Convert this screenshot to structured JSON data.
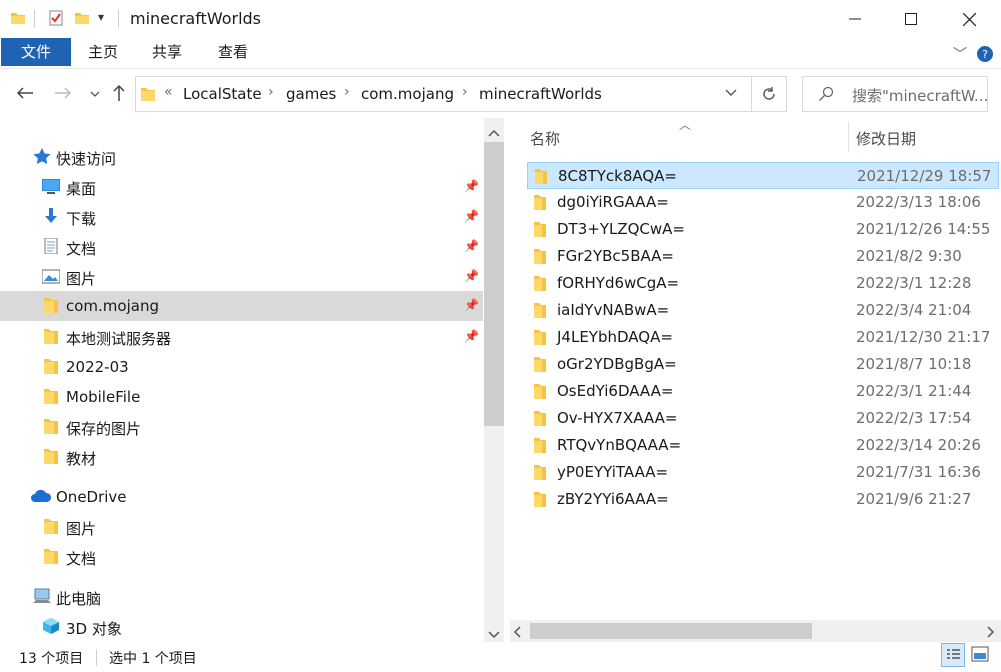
{
  "window": {
    "title": "minecraftWorlds",
    "minimize_icon": "minimize-icon",
    "maximize_icon": "maximize-icon",
    "close_icon": "close-icon"
  },
  "ribbon": {
    "tabs": [
      "文件",
      "主页",
      "共享",
      "查看"
    ]
  },
  "address": {
    "overflow": "«",
    "crumbs": [
      "LocalState",
      "games",
      "com.mojang",
      "minecraftWorlds"
    ],
    "search_placeholder": "搜索\"minecraftW..."
  },
  "nav": {
    "quick_access": "快速访问",
    "items": [
      {
        "label": "桌面",
        "icon": "desktop-icon",
        "pinned": true
      },
      {
        "label": "下载",
        "icon": "download-icon",
        "pinned": true
      },
      {
        "label": "文档",
        "icon": "document-icon",
        "pinned": true
      },
      {
        "label": "图片",
        "icon": "picture-icon",
        "pinned": true
      },
      {
        "label": "com.mojang",
        "icon": "folder-icon",
        "pinned": true,
        "selected": true
      },
      {
        "label": "本地测试服务器",
        "icon": "folder-icon",
        "pinned": true
      },
      {
        "label": "2022-03",
        "icon": "folder-icon"
      },
      {
        "label": "MobileFile",
        "icon": "folder-icon"
      },
      {
        "label": "保存的图片",
        "icon": "folder-icon"
      },
      {
        "label": "教材",
        "icon": "folder-icon"
      }
    ],
    "onedrive": "OneDrive",
    "onedrive_items": [
      {
        "label": "图片",
        "icon": "folder-icon"
      },
      {
        "label": "文档",
        "icon": "folder-icon"
      }
    ],
    "this_pc": "此电脑",
    "this_pc_items": [
      {
        "label": "3D 对象",
        "icon": "3d-objects-icon"
      }
    ]
  },
  "columns": {
    "name": "名称",
    "date": "修改日期"
  },
  "files": [
    {
      "name": "8C8TYck8AQA=",
      "date": "2021/12/29 18:57",
      "selected": true
    },
    {
      "name": "dg0iYiRGAAA=",
      "date": "2022/3/13 18:06"
    },
    {
      "name": "DT3+YLZQCwA=",
      "date": "2021/12/26 14:55"
    },
    {
      "name": "FGr2YBc5BAA=",
      "date": "2021/8/2 9:30"
    },
    {
      "name": "fORHYd6wCgA=",
      "date": "2022/3/1 12:28"
    },
    {
      "name": "iaIdYvNABwA=",
      "date": "2022/3/4 21:04"
    },
    {
      "name": "J4LEYbhDAQA=",
      "date": "2021/12/30 21:17"
    },
    {
      "name": "oGr2YDBgBgA=",
      "date": "2021/8/7 10:18"
    },
    {
      "name": "OsEdYi6DAAA=",
      "date": "2022/3/1 21:44"
    },
    {
      "name": "Ov-HYX7XAAA=",
      "date": "2022/2/3 17:54"
    },
    {
      "name": "RTQvYnBQAAA=",
      "date": "2022/3/14 20:26"
    },
    {
      "name": "yP0EYYiTAAA=",
      "date": "2021/7/31 16:36"
    },
    {
      "name": "zBY2YYi6AAA=",
      "date": "2021/9/6 21:27"
    }
  ],
  "status": {
    "count": "13 个项目",
    "selected": "选中 1 个项目"
  },
  "colors": {
    "accent": "#1f64b4",
    "selection": "#cce8ff",
    "folder": "#f6c343",
    "nav_selected": "#d9d9d9"
  }
}
